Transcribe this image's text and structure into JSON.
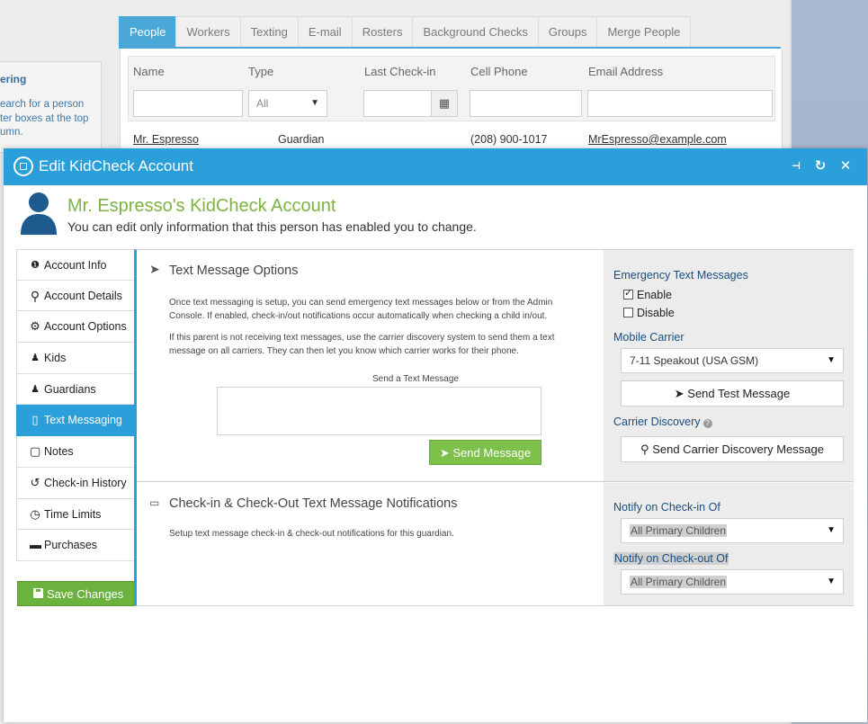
{
  "background": {
    "left_panel": {
      "title": "ering",
      "text": "earch for a person ter boxes at the top umn."
    },
    "tabs": [
      "People",
      "Workers",
      "Texting",
      "E-mail",
      "Rosters",
      "Background Checks",
      "Groups",
      "Merge People"
    ],
    "active_tab": "People",
    "columns": [
      "Name",
      "Type",
      "Last Check-in",
      "Cell Phone",
      "Email Address"
    ],
    "type_filter_value": "All",
    "row": {
      "name": "Mr. Espresso",
      "type": "Guardian",
      "phone": "(208) 900-1017",
      "email": "MrEspresso@example.com"
    }
  },
  "modal": {
    "title": "Edit KidCheck Account",
    "account_name": "Mr. Espresso's KidCheck Account",
    "account_subtitle": "You can edit only information that this person has enabled you to change."
  },
  "sidebar": {
    "items": [
      {
        "label": "Account Info",
        "icon": "info-circle-icon",
        "glyph": "❶"
      },
      {
        "label": "Account Details",
        "icon": "search-icon",
        "glyph": "⚲"
      },
      {
        "label": "Account Options",
        "icon": "gear-icon",
        "glyph": "⚙"
      },
      {
        "label": "Kids",
        "icon": "child-icon",
        "glyph": "♟"
      },
      {
        "label": "Guardians",
        "icon": "person-icon",
        "glyph": "♟"
      },
      {
        "label": "Text Messaging",
        "icon": "mobile-phone-icon",
        "glyph": "▯"
      },
      {
        "label": "Notes",
        "icon": "note-icon",
        "glyph": "▢"
      },
      {
        "label": "Check-in History",
        "icon": "history-icon",
        "glyph": "↺"
      },
      {
        "label": "Time Limits",
        "icon": "clock-icon",
        "glyph": "◷"
      },
      {
        "label": "Purchases",
        "icon": "credit-card-icon",
        "glyph": "▬"
      }
    ],
    "active_item": "Text Messaging",
    "save_label": "Save Changes"
  },
  "text_options": {
    "title": "Text Message Options",
    "para1": "Once text messaging is setup, you can send emergency text messages below or from the Admin Console. If enabled, check-in/out notifications occur automatically when checking a child in/out.",
    "para2": "If this parent is not receiving text messages, use the carrier discovery system to send them a text message on all carriers. They can then let you know which carrier works for their phone.",
    "send_label": "Send a Text Message",
    "send_value": "",
    "send_button": "Send Message"
  },
  "emergency": {
    "label": "Emergency Text Messages",
    "enable_label": "Enable",
    "enable_checked": true,
    "disable_label": "Disable",
    "disable_checked": false,
    "carrier_label": "Mobile Carrier",
    "carrier_value": "7-11 Speakout (USA GSM)",
    "test_button": "Send Test Message",
    "discovery_label": "Carrier Discovery",
    "discovery_button": "Send Carrier Discovery Message"
  },
  "notifications": {
    "title": "Check-in & Check-Out Text Message Notifications",
    "text": "Setup text message check-in & check-out notifications for this guardian.",
    "checkin_label": "Notify on Check-in Of",
    "checkin_value": "All Primary Children",
    "checkout_label": "Notify on Check-out Of",
    "checkout_value": "All Primary Children"
  },
  "colors": {
    "accent": "#2b9fd9",
    "green": "#7cb342",
    "button_green": "#7dc04a"
  }
}
